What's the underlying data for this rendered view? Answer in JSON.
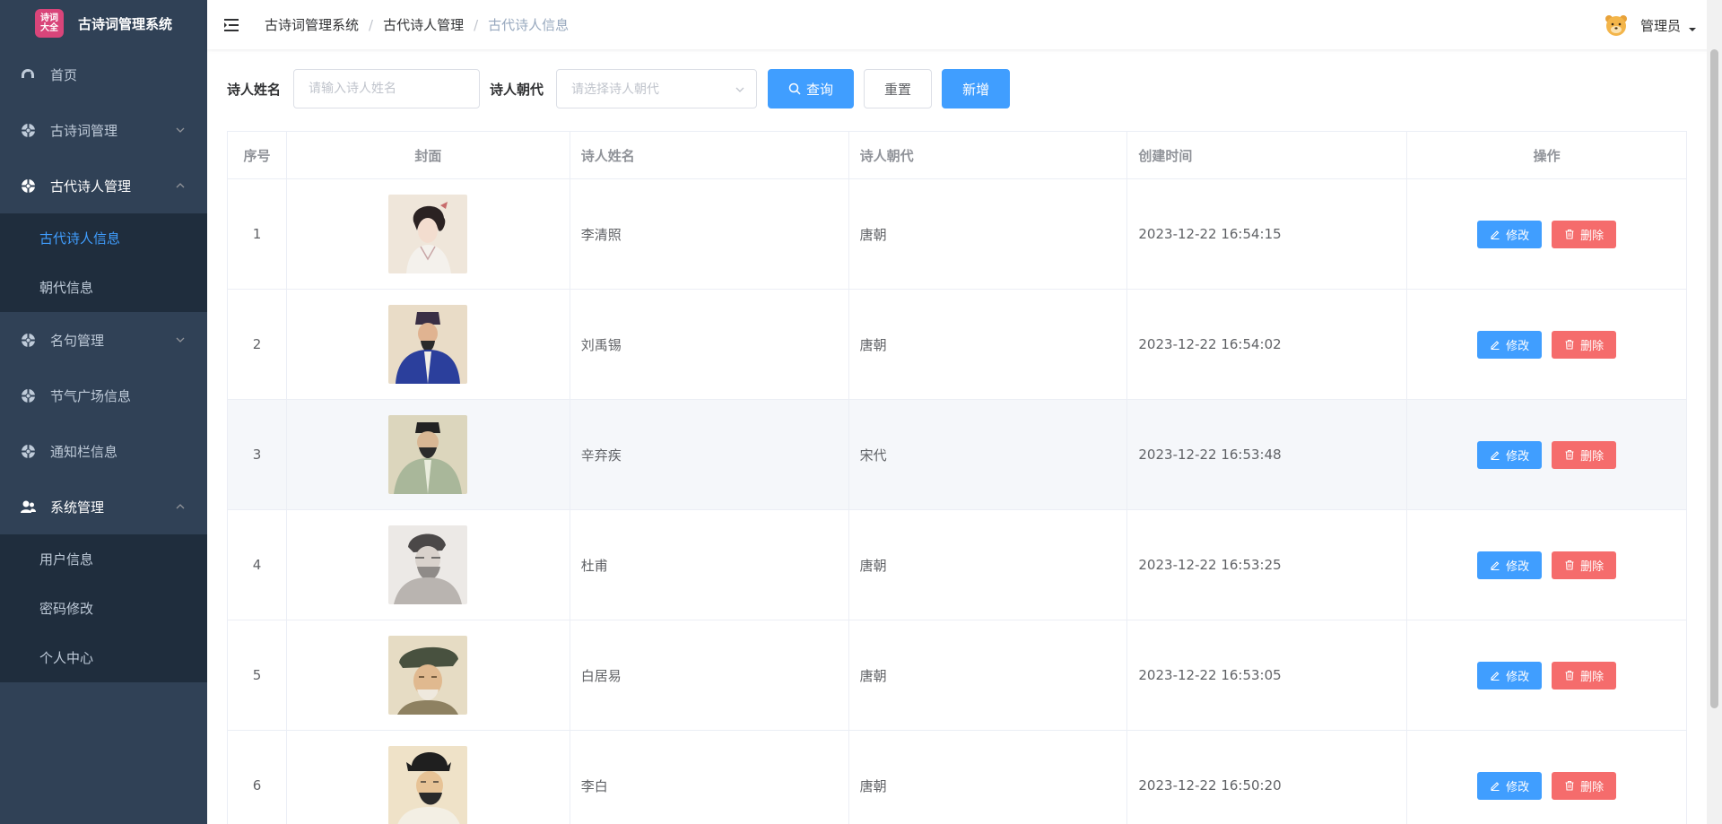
{
  "app": {
    "title": "古诗词管理系统",
    "logo_text": "诗词\n大全"
  },
  "sidebar": {
    "home": "首页",
    "poetry_mgmt": "古诗词管理",
    "poet_mgmt": "古代诗人管理",
    "poet_info": "古代诗人信息",
    "dynasty_info": "朝代信息",
    "quotes_mgmt": "名句管理",
    "solar_terms": "节气广场信息",
    "notice": "通知栏信息",
    "system_mgmt": "系统管理",
    "user_info": "用户信息",
    "password_change": "密码修改",
    "personal_center": "个人中心"
  },
  "breadcrumb": [
    "古诗词管理系统",
    "古代诗人管理",
    "古代诗人信息"
  ],
  "user": {
    "name": "管理员"
  },
  "search": {
    "name_label": "诗人姓名",
    "name_placeholder": "请输入诗人姓名",
    "dynasty_label": "诗人朝代",
    "dynasty_placeholder": "请选择诗人朝代",
    "query_button": "查询",
    "reset_button": "重置",
    "add_button": "新增"
  },
  "table": {
    "columns": [
      "序号",
      "封面",
      "诗人姓名",
      "诗人朝代",
      "创建时间",
      "操作"
    ],
    "edit_label": "修改",
    "delete_label": "删除",
    "rows": [
      {
        "index": "1",
        "name": "李清照",
        "dynasty": "唐朝",
        "created": "2023-12-22 16:54:15"
      },
      {
        "index": "2",
        "name": "刘禹锡",
        "dynasty": "唐朝",
        "created": "2023-12-22 16:54:02"
      },
      {
        "index": "3",
        "name": "辛弃疾",
        "dynasty": "宋代",
        "created": "2023-12-22 16:53:48"
      },
      {
        "index": "4",
        "name": "杜甫",
        "dynasty": "唐朝",
        "created": "2023-12-22 16:53:25"
      },
      {
        "index": "5",
        "name": "白居易",
        "dynasty": "唐朝",
        "created": "2023-12-22 16:53:05"
      },
      {
        "index": "6",
        "name": "李白",
        "dynasty": "唐朝",
        "created": "2023-12-22 16:50:20"
      }
    ]
  },
  "colors": {
    "sidebar_bg": "#304156",
    "submenu_bg": "#1f2d3d",
    "active_text": "#409eff",
    "primary": "#409eff",
    "danger": "#f56c6c"
  }
}
